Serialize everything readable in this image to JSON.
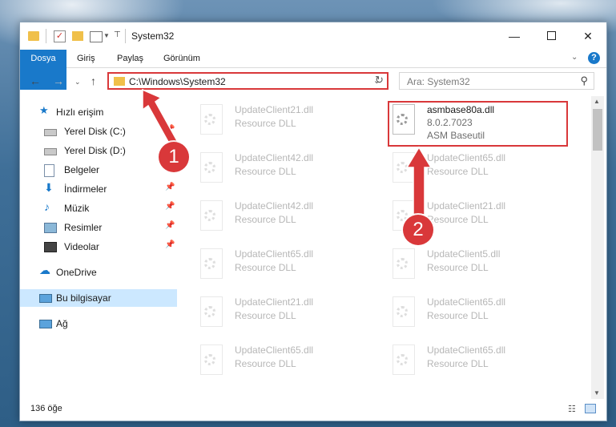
{
  "window": {
    "title": "System32",
    "controls": {
      "minimize": "—",
      "maximize": "□",
      "close": "✕"
    }
  },
  "ribbon": {
    "tabs": [
      "Dosya",
      "Giriş",
      "Paylaş",
      "Görünüm"
    ],
    "help": "?"
  },
  "nav": {
    "address": "C:\\Windows\\System32",
    "search_placeholder": "Ara: System32"
  },
  "sidebar": {
    "items": [
      {
        "label": "Hızlı erişim",
        "icon": "star-icon"
      },
      {
        "label": "Yerel Disk (C:)",
        "icon": "drive-icon",
        "pinned": true
      },
      {
        "label": "Yerel Disk (D:)",
        "icon": "drive-icon",
        "pinned": true
      },
      {
        "label": "Belgeler",
        "icon": "documents-icon",
        "pinned": true
      },
      {
        "label": "İndirmeler",
        "icon": "downloads-icon",
        "pinned": true
      },
      {
        "label": "Müzik",
        "icon": "music-icon",
        "pinned": true
      },
      {
        "label": "Resimler",
        "icon": "pictures-icon",
        "pinned": true
      },
      {
        "label": "Videolar",
        "icon": "videos-icon",
        "pinned": true
      },
      {
        "label": "OneDrive",
        "icon": "cloud-icon"
      },
      {
        "label": "Bu bilgisayar",
        "icon": "computer-icon",
        "selected": true
      },
      {
        "label": "Ağ",
        "icon": "network-icon"
      }
    ]
  },
  "files": {
    "left_column": [
      {
        "name": "UpdateClient21.dll",
        "desc": "Resource DLL"
      },
      {
        "name": "UpdateClient42.dll",
        "desc": "Resource DLL"
      },
      {
        "name": "UpdateClient42.dll",
        "desc": "Resource DLL"
      },
      {
        "name": "UpdateClient65.dll",
        "desc": "Resource DLL"
      },
      {
        "name": "UpdateClient21.dll",
        "desc": "Resource DLL"
      },
      {
        "name": "UpdateClient65.dll",
        "desc": "Resource DLL"
      }
    ],
    "right_column": [
      {
        "name": "asmbase80a.dll",
        "version": "8.0.2.7023",
        "desc": "ASM Baseutil",
        "highlighted": true
      },
      {
        "name": "UpdateClient65.dll",
        "desc": "Resource DLL"
      },
      {
        "name": "UpdateClient21.dll",
        "desc": "Resource DLL"
      },
      {
        "name": "UpdateClient5.dll",
        "desc": "Resource DLL"
      },
      {
        "name": "UpdateClient65.dll",
        "desc": "Resource DLL"
      },
      {
        "name": "UpdateClient65.dll",
        "desc": "Resource DLL"
      }
    ]
  },
  "status": {
    "count": "136 öğe"
  },
  "annotations": {
    "badge1": "1",
    "badge2": "2",
    "color": "#d9383a"
  }
}
